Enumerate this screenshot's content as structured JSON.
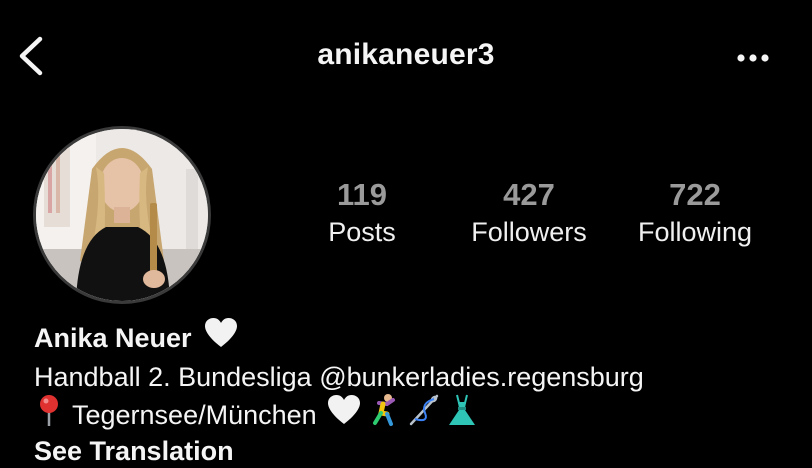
{
  "header": {
    "username": "anikaneuer3",
    "back_icon": "chevron-left-icon",
    "more_icon": "ellipsis-icon"
  },
  "profile": {
    "stats": [
      {
        "value": "119",
        "label": "Posts"
      },
      {
        "value": "427",
        "label": "Followers"
      },
      {
        "value": "722",
        "label": "Following"
      }
    ]
  },
  "bio": {
    "name": "Anika Neuer",
    "line1": "Handball 2. Bundesliga @bunkerladies.regensburg",
    "line2": "Tegernsee/München",
    "see_translation": "See Translation",
    "emojis": [
      "white-heart",
      "round-pushpin",
      "dancing-person",
      "sewing-needle",
      "dress"
    ]
  },
  "colors": {
    "background": "#000000",
    "text": "#f5f5f5",
    "stat_number": "#9a9a9a",
    "dress": "#2ec4b6",
    "pin": "#e03131"
  }
}
